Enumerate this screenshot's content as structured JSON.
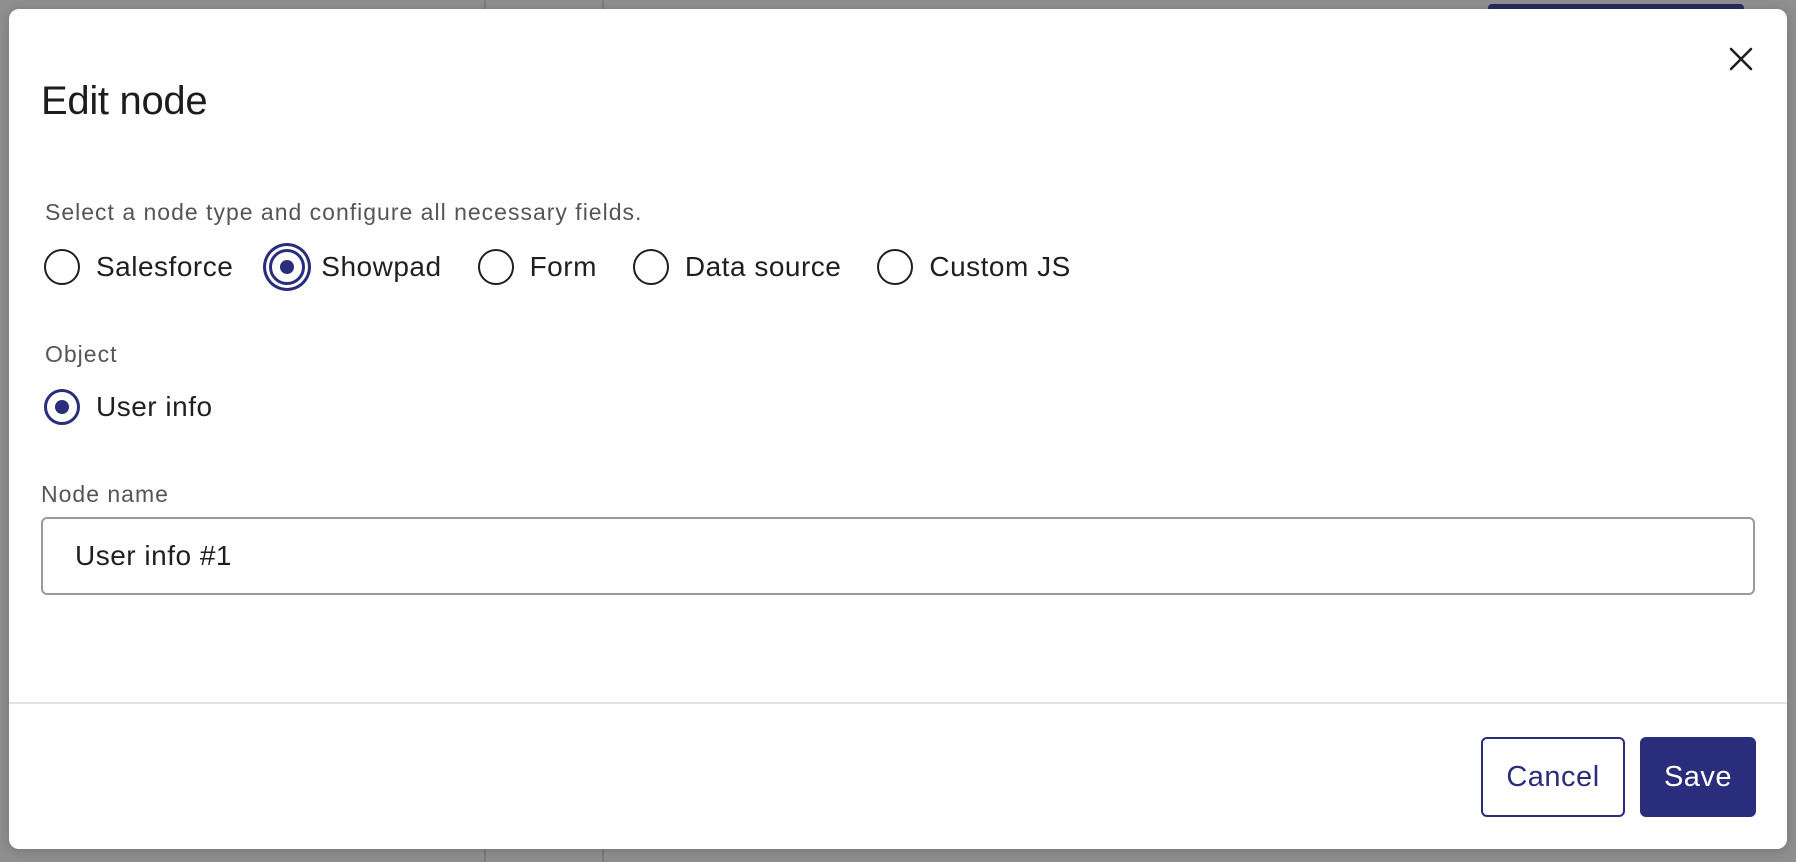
{
  "dialog": {
    "title": "Edit node",
    "description": "Select a node type and configure all necessary fields.",
    "node_types": [
      {
        "label": "Salesforce",
        "checked": false
      },
      {
        "label": "Showpad",
        "checked": true
      },
      {
        "label": "Form",
        "checked": false
      },
      {
        "label": "Data source",
        "checked": false
      },
      {
        "label": "Custom JS",
        "checked": false
      }
    ],
    "object": {
      "label": "Object",
      "options": [
        {
          "label": "User info",
          "checked": true
        }
      ]
    },
    "node_name": {
      "label": "Node name",
      "value": "User info #1"
    },
    "footer": {
      "cancel_label": "Cancel",
      "save_label": "Save"
    }
  },
  "icons": {
    "close": "close-icon"
  },
  "colors": {
    "accent": "#2a2d7c",
    "backdrop": "#8f8f8f"
  }
}
